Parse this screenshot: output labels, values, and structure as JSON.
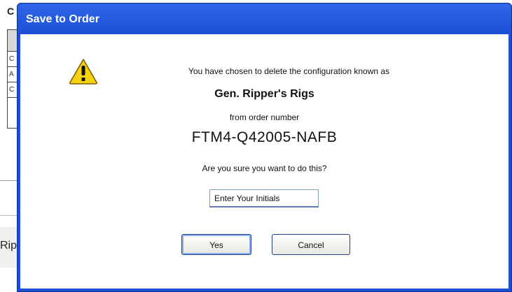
{
  "background": {
    "heading_fragment": "C",
    "table_rows": [
      "C",
      "A",
      "C"
    ],
    "text_fragment": "Rip"
  },
  "dialog": {
    "title": "Save to Order",
    "icon": "warning-icon",
    "message": "You have chosen to delete the configuration known as",
    "config_name": "Gen. Ripper's Rigs",
    "from_text": "from order number",
    "order_number": "FTM4-Q42005-NAFB",
    "question": "Are you sure you want to do this?",
    "initials_value": "Enter Your Initials",
    "yes_label": "Yes",
    "cancel_label": "Cancel"
  },
  "colors": {
    "titlebar": "#1c4fd6",
    "warning_yellow": "#f5d20c"
  }
}
